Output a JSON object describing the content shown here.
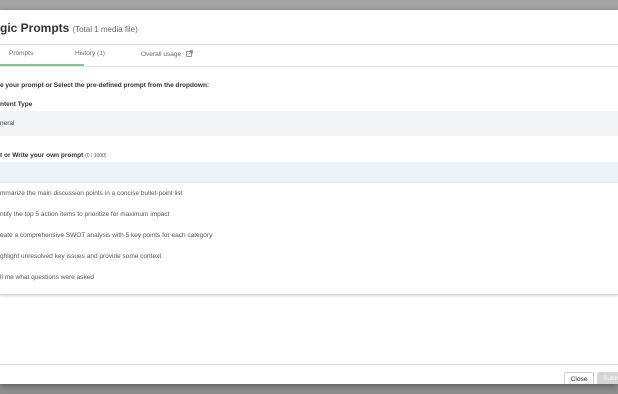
{
  "dialog": {
    "title": "gic Prompts",
    "subtitle": "(Total 1 media file)"
  },
  "tabs": [
    {
      "label": "Prompts",
      "active": true
    },
    {
      "label": "History (1)",
      "active": false
    },
    {
      "label": "Overall usage",
      "active": false,
      "icon": "external-link-icon"
    }
  ],
  "instructions": "e your prompt or Select the pre-defined prompt from the dropdown:",
  "content_type": {
    "label": "ntent Type",
    "value": "neral"
  },
  "prompt": {
    "label": "t or Write your own prompt",
    "counter": "(0 / 1000)",
    "value": ""
  },
  "dropdown_options": [
    "mmarize the main discussion points in a concise bullet-point list",
    "ntify the top 5 action items to prioritize for maximum impact",
    "eate a comprehensive SWOT analysis with 5 key points for each category",
    "ghlight unresolved key issues and provide some context",
    "ll me what questions were asked"
  ],
  "footer": {
    "close_label": "Close",
    "submit_label": "Subm"
  },
  "colors": {
    "active_tab": "#79c887",
    "input_focus": "#e59ab3",
    "backdrop": "#8e8e8e"
  }
}
